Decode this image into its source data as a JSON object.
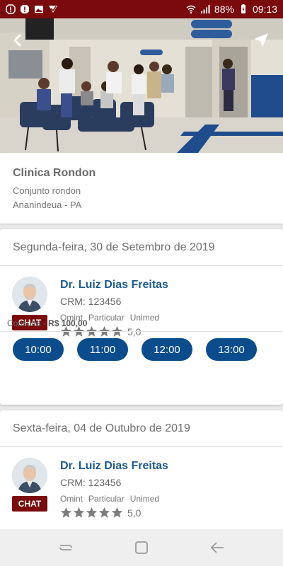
{
  "status_bar": {
    "battery": "88%",
    "time": "09:13",
    "left_icons": [
      "alert-icon",
      "alert-icon",
      "image-icon",
      "flag-icon"
    ],
    "right_icons": [
      "wifi-icon",
      "signal-icon",
      "battery-icon"
    ]
  },
  "hero": {
    "back_icon": "chevron-left-icon",
    "navigate_icon": "navigation-arrow-icon"
  },
  "clinic": {
    "name": "Clinica Rondon",
    "address_line": "Conjunto rondon",
    "city_line": "Ananindeua - PA"
  },
  "days": [
    {
      "date": "Segunda-feira, 30 de Setembro de 2019",
      "doctor": {
        "name": "Dr. Luiz Dias Freitas",
        "crm": "CRM: 123456",
        "plans": [
          "Omint",
          "Particular",
          "Unimed"
        ],
        "rating": "5,0",
        "stars": 5,
        "chat_label": "CHAT"
      },
      "price_label": "Consulta - ",
      "price_value": "R$ 100,00",
      "slots": [
        "10:00",
        "11:00",
        "12:00",
        "13:00"
      ]
    },
    {
      "date": "Sexta-feira, 04 de Outubro de 2019",
      "doctor": {
        "name": "Dr. Luiz Dias Freitas",
        "crm": "CRM: 123456",
        "plans": [
          "Omint",
          "Particular",
          "Unimed"
        ],
        "rating": "5,0",
        "stars": 5,
        "chat_label": "CHAT"
      }
    }
  ],
  "nav_bar": {
    "icons": [
      "recent-apps-icon",
      "home-icon",
      "back-icon"
    ]
  },
  "colors": {
    "brand": "#7a0a0c",
    "slot": "#0b4c8c",
    "doctor_name": "#1d5a93"
  }
}
